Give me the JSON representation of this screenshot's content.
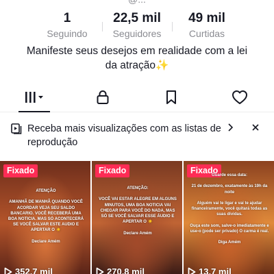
{
  "header": {
    "username_partial": "@..."
  },
  "stats": [
    {
      "value": "1",
      "label": "Seguindo"
    },
    {
      "value": "22,5 mil",
      "label": "Seguidores"
    },
    {
      "value": "49 mil",
      "label": "Curtidas"
    }
  ],
  "bio": "Manifeste seus desejos em realidade com a lei da atração✨",
  "tabs": [
    {
      "icon": "videos-grid-icon",
      "active": true
    },
    {
      "icon": "lock-icon",
      "active": false
    },
    {
      "icon": "bookmark-icon",
      "active": false
    },
    {
      "icon": "heart-icon",
      "active": false
    }
  ],
  "promo": {
    "text": "Receba mais visualizações com as listas de reprodução",
    "icon": "playlist-icon"
  },
  "videos": [
    {
      "badge": "Fixado",
      "caption": "ATENÇÃO\n\nAMANHÃ DE MANHÃ QUANDO VOCÊ ACORDAR VEJA SEU SALDO BANCARIO. VOCÊ RECEBERÁ UMA BOA NOTICIA. MAS SÓ ACONTECERÁ SE VOCÊ SALVAR ESTE AUDIO E APERTAR O ☀️\n\nDeclare Amém",
      "views": "352,7 mil",
      "colors": [
        "#6e2e1c",
        "#b4542a",
        "#d8743a",
        "#5a2418"
      ]
    },
    {
      "badge": "Fixado",
      "caption": "ATENÇÃO:\n\nVOCÊ VAI ESTAR ALEGRE EM ALGUNS MINUTOS, UMA BOA NOTICIA VAI CHEGAR PARA VOCÊ DO NADA, MAS SÓ SE VOCÊ SALVAR ESSE ÁUDIO E APERTAR O ☀️\n\nDeclare Amém",
      "views": "270,8 mil",
      "colors": [
        "#7a3a22",
        "#c06434",
        "#a24a2a",
        "#3c1c16"
      ]
    },
    {
      "badge": "Fixado",
      "caption": "Guarde essa data:\n\n21 de dezembro, exatamente às 19h da noite\n\nAlguém vai te ligar e vai te ajudar financeiramente, você quitará todas as suas dívidas.\n\nOuça este som, salve-o imediatamente e use-o (pode ser privado) O carma é real.\n\nDiga Amém",
      "views": "13,7 mil",
      "colors": [
        "#8c4220",
        "#e08a3a",
        "#c8622a",
        "#6a3018"
      ]
    }
  ],
  "colors": {
    "accent": "#fe2c55",
    "text": "#161823",
    "muted": "#8a8b91"
  }
}
